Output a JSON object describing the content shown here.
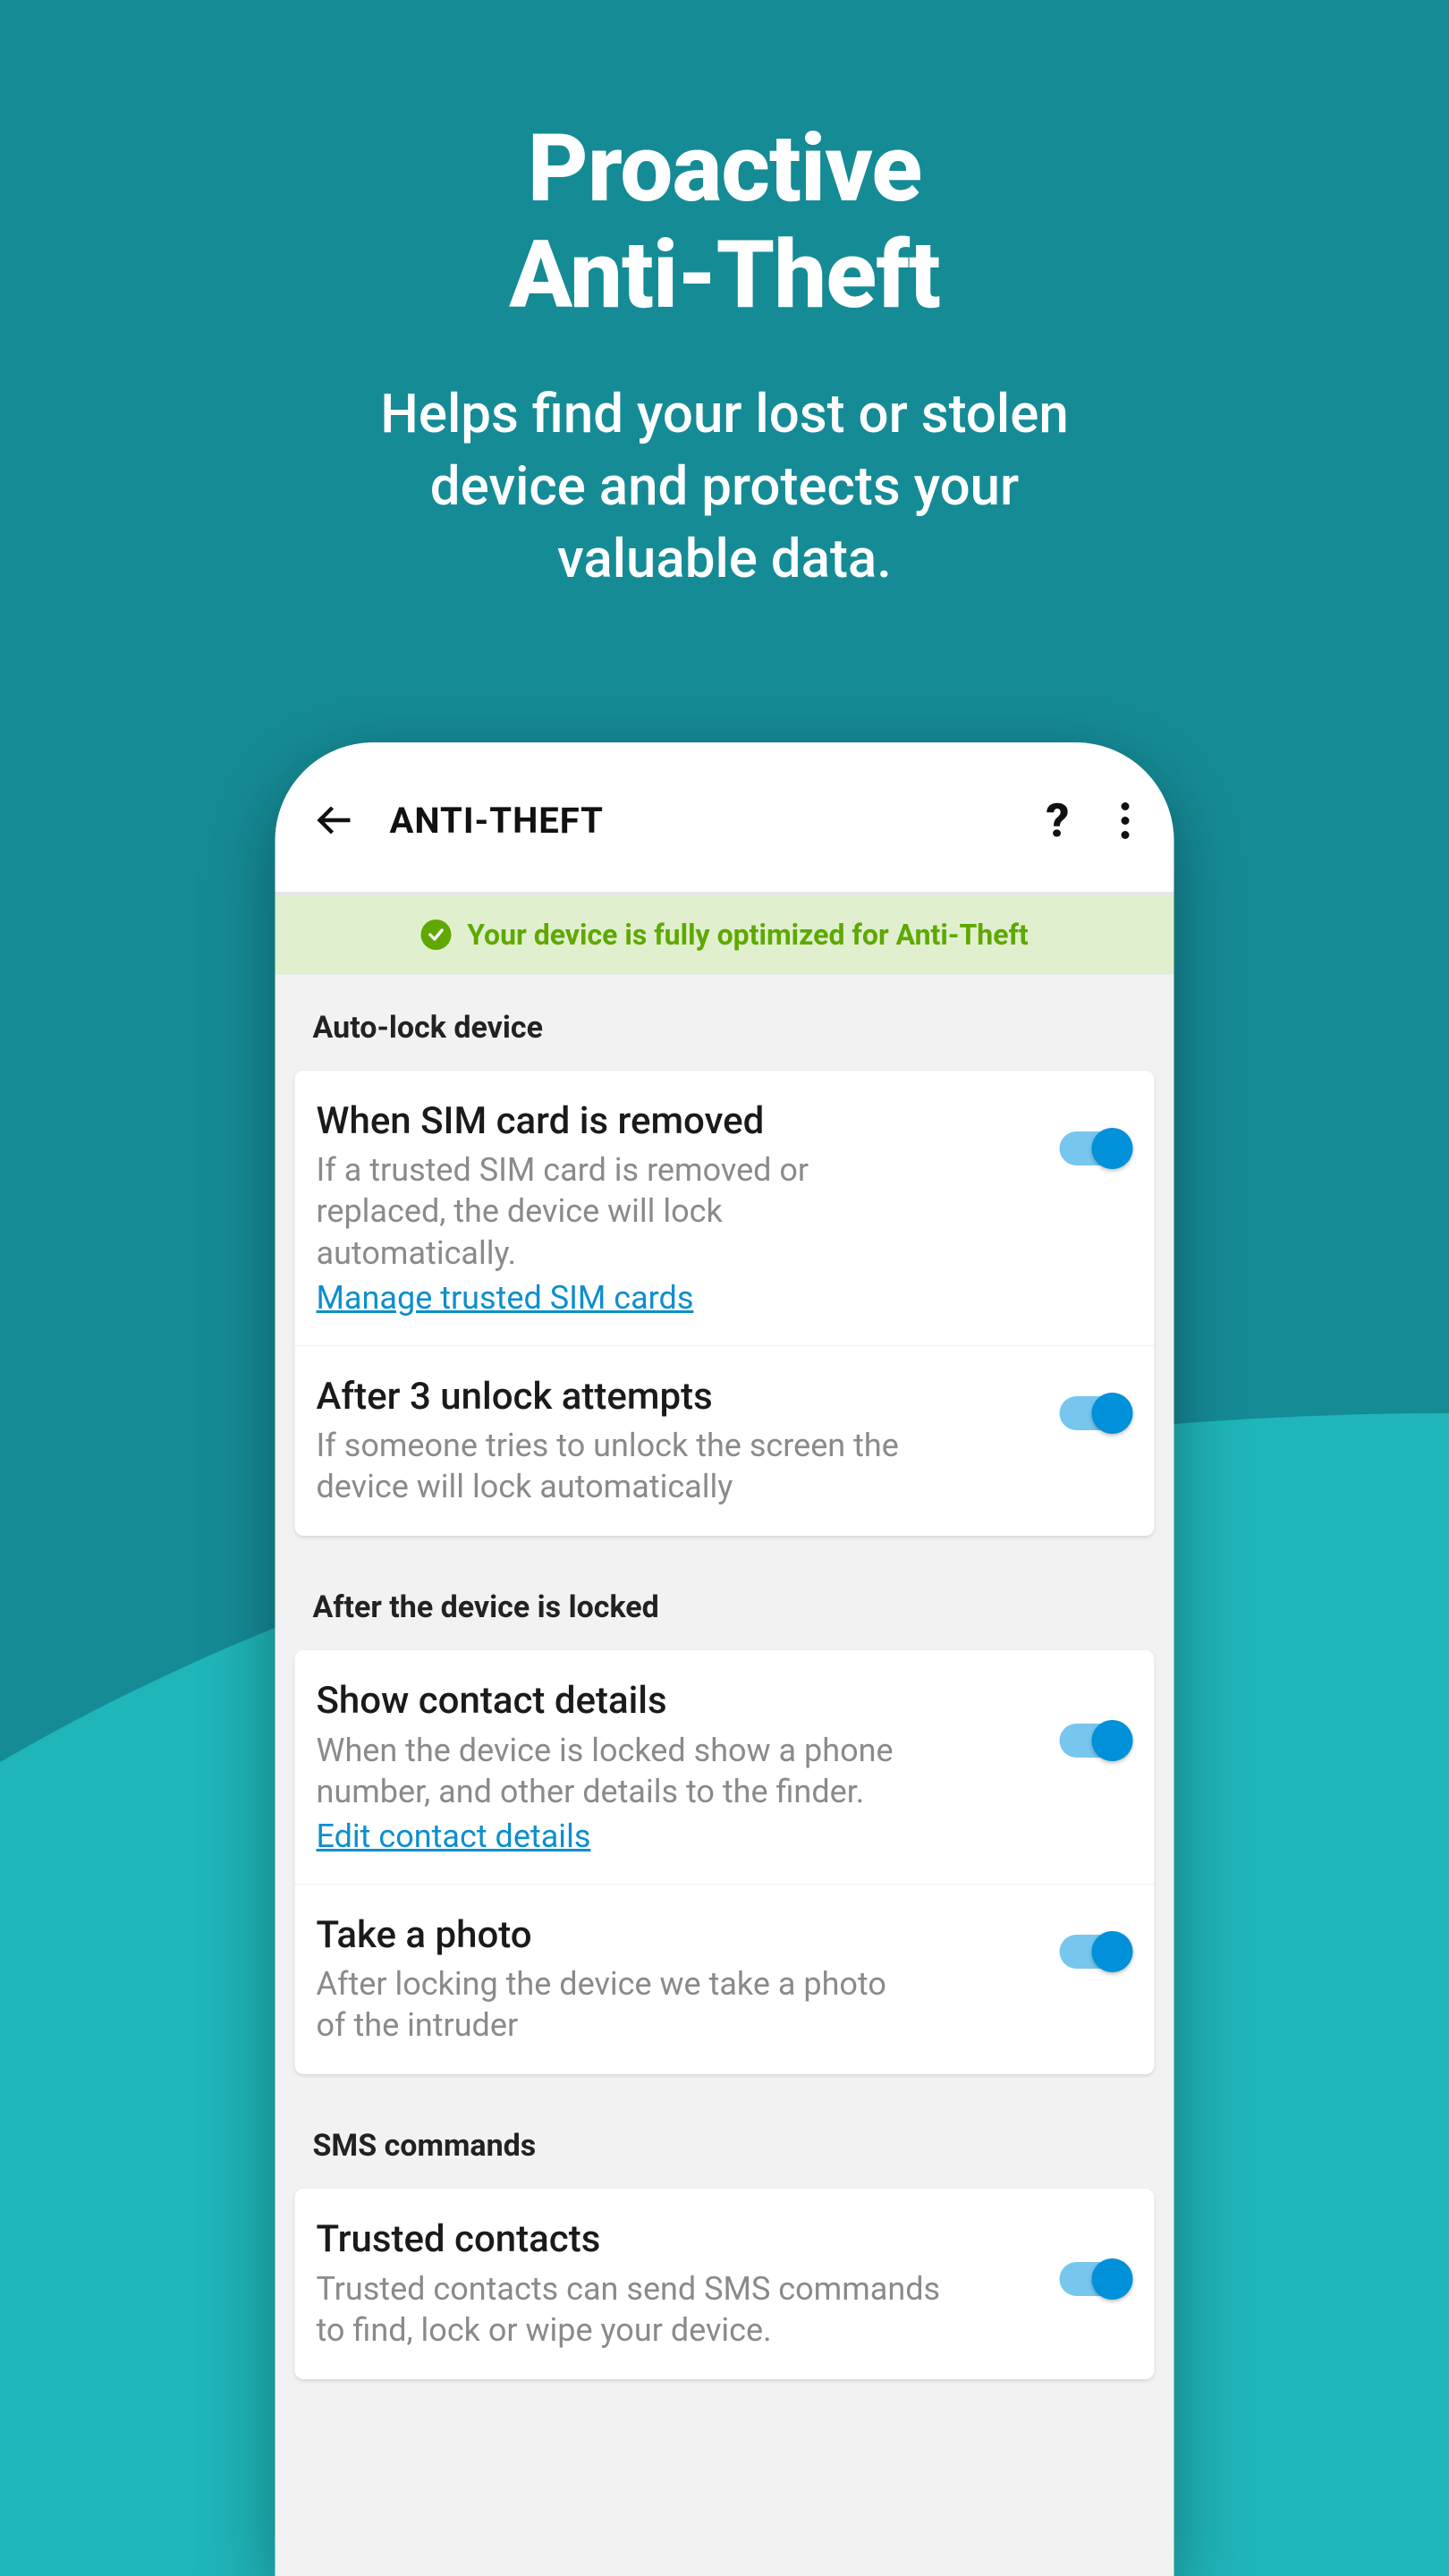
{
  "promo": {
    "title_line1": "Proactive",
    "title_line2": "Anti-Theft",
    "sub_line1": "Helps find your lost or stolen",
    "sub_line2": "device and protects your",
    "sub_line3": "valuable data."
  },
  "app_bar": {
    "title": "ANTI-THEFT"
  },
  "status": {
    "text": "Your device is fully optimized for Anti-Theft"
  },
  "sections": {
    "autolock": {
      "header": "Auto-lock device",
      "sim": {
        "title": "When SIM card is removed",
        "desc": "If a trusted SIM card is removed or replaced, the device will lock automatically.",
        "link": "Manage trusted SIM cards"
      },
      "attempts": {
        "title": "After 3 unlock attempts",
        "desc": "If someone tries to unlock the screen the device will lock automatically"
      }
    },
    "after_lock": {
      "header": "After the device is locked",
      "contact": {
        "title": "Show contact details",
        "desc": "When the device is locked show a phone number, and other details to the finder.",
        "link": "Edit contact details"
      },
      "photo": {
        "title": "Take a photo",
        "desc": "After locking the device we take a photo of the intruder"
      }
    },
    "sms": {
      "header": "SMS commands",
      "trusted": {
        "title": "Trusted contacts",
        "desc": "Trusted contacts can send SMS commands to find, lock or wipe your device."
      }
    }
  }
}
